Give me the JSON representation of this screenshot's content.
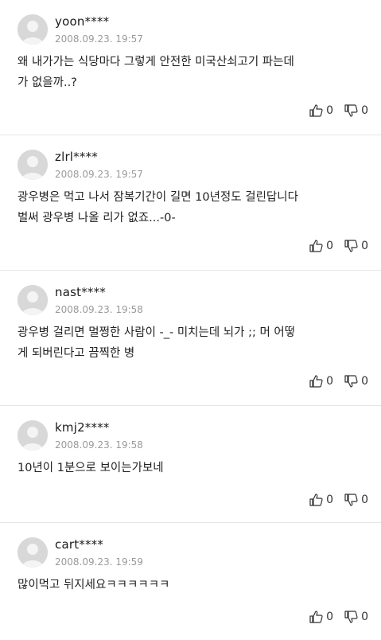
{
  "comments": [
    {
      "username": "yoon****",
      "timestamp": "2008.09.23. 19:57",
      "lines": [
        "왜 내가가는 식당마다 그렇게 안전한 미국산쇠고기 파는데",
        "가 없을까..?"
      ],
      "likes": "0",
      "dislikes": "0"
    },
    {
      "username": "zlrl****",
      "timestamp": "2008.09.23. 19:57",
      "lines": [
        "광우병은 먹고 나서 잠복기간이 길면 10년정도 걸린답니다",
        "벌써 광우병 나올 리가 없죠...-0-"
      ],
      "likes": "0",
      "dislikes": "0"
    },
    {
      "username": "nast****",
      "timestamp": "2008.09.23. 19:58",
      "lines": [
        "광우병 걸리면 멀쩡한 사람이 -_- 미치는데 뇌가 ;; 머 어떻",
        "게 되버린다고 끔찍한 병"
      ],
      "likes": "0",
      "dislikes": "0"
    },
    {
      "username": "kmj2****",
      "timestamp": "2008.09.23. 19:58",
      "lines": [
        "10년이 1분으로 보이는가보네"
      ],
      "likes": "0",
      "dislikes": "0"
    },
    {
      "username": "cart****",
      "timestamp": "2008.09.23. 19:59",
      "lines": [
        "많이먹고 뒤지세요ㅋㅋㅋㅋㅋㅋ"
      ],
      "likes": "0",
      "dislikes": "0"
    }
  ],
  "icons": {
    "avatar": "default-avatar-icon",
    "like": "thumbs-up-icon",
    "dislike": "thumbs-down-icon"
  }
}
